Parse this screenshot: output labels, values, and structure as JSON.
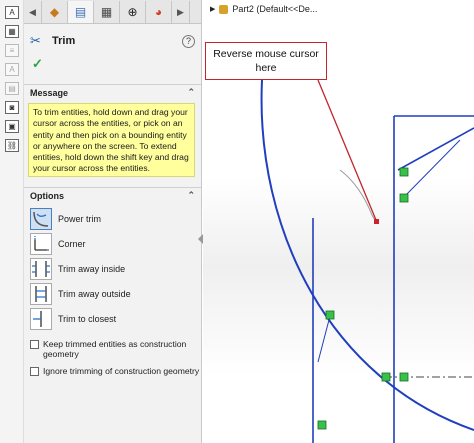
{
  "feature_tree": {
    "item": "Part2  (Default<<De..."
  },
  "property_manager": {
    "title": "Trim",
    "help": "?",
    "ok": "✓",
    "message_group": {
      "header": "Message",
      "text": "To trim entities, hold down and drag your cursor across the entities, or pick on an entity and then pick on a bounding entity or anywhere on the screen. To extend entities, hold down the shift key and drag your cursor across the entities."
    },
    "options_group": {
      "header": "Options",
      "items": [
        {
          "label": "Power trim",
          "selected": true
        },
        {
          "label": "Corner",
          "selected": false
        },
        {
          "label": "Trim away inside",
          "selected": false
        },
        {
          "label": "Trim away outside",
          "selected": false
        },
        {
          "label": "Trim to closest",
          "selected": false
        }
      ],
      "checkboxes": [
        {
          "label": "Keep trimmed entities as construction geometry",
          "checked": false
        },
        {
          "label": "Ignore trimming of construction geometry",
          "checked": false
        }
      ]
    }
  },
  "annotation": {
    "text": "Reverse mouse cursor here"
  },
  "colors": {
    "accent": "#1d5ca7",
    "message_bg": "#ffff9e",
    "sketch_line": "#1f3fbf",
    "callout_border": "#c0262b",
    "relation_marker": "#38c14a"
  }
}
